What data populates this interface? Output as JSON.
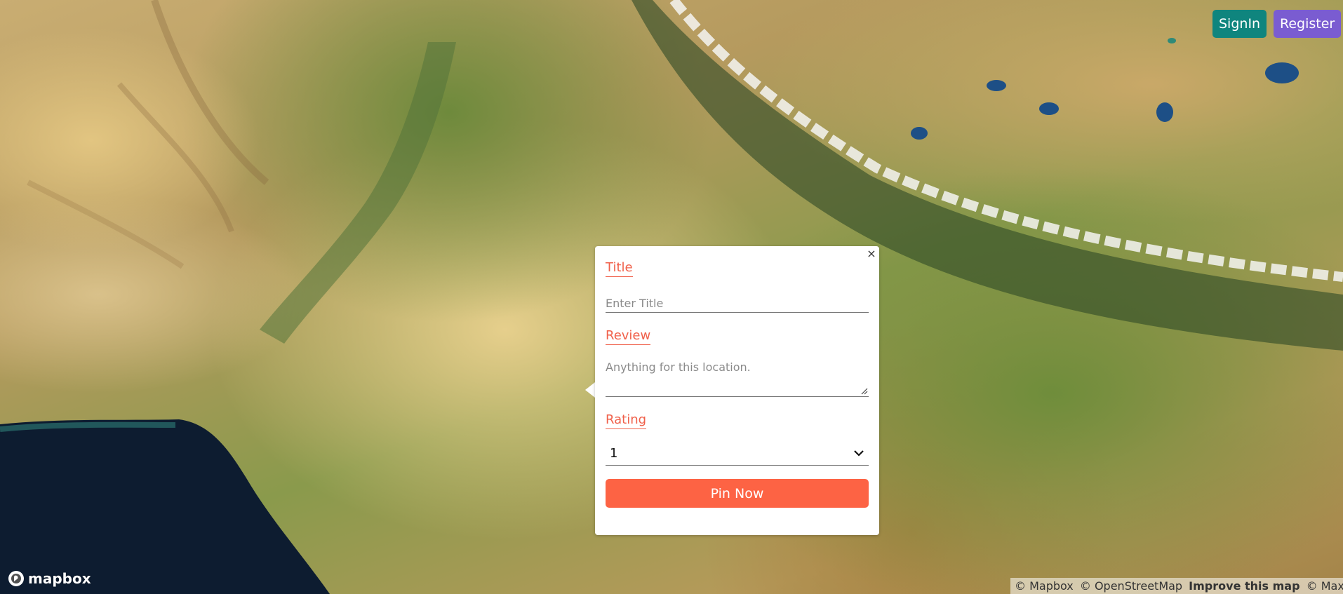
{
  "header": {
    "signin_label": "SignIn",
    "register_label": "Register",
    "signin_color": "#0f857e",
    "register_color": "#7a5cd1"
  },
  "popup": {
    "close_label": "×",
    "title_label": "Title",
    "title_placeholder": "Enter Title",
    "review_label": "Review",
    "review_placeholder": "Anything for this location.",
    "rating_label": "Rating",
    "rating_value": "1",
    "submit_label": "Pin Now",
    "accent_color": "#fd6344"
  },
  "map": {
    "logo_text": "mapbox",
    "attribution": {
      "mapbox": "© Mapbox",
      "osm": "© OpenStreetMap",
      "improve": "Improve this map",
      "maxar": "© Maxar"
    }
  }
}
